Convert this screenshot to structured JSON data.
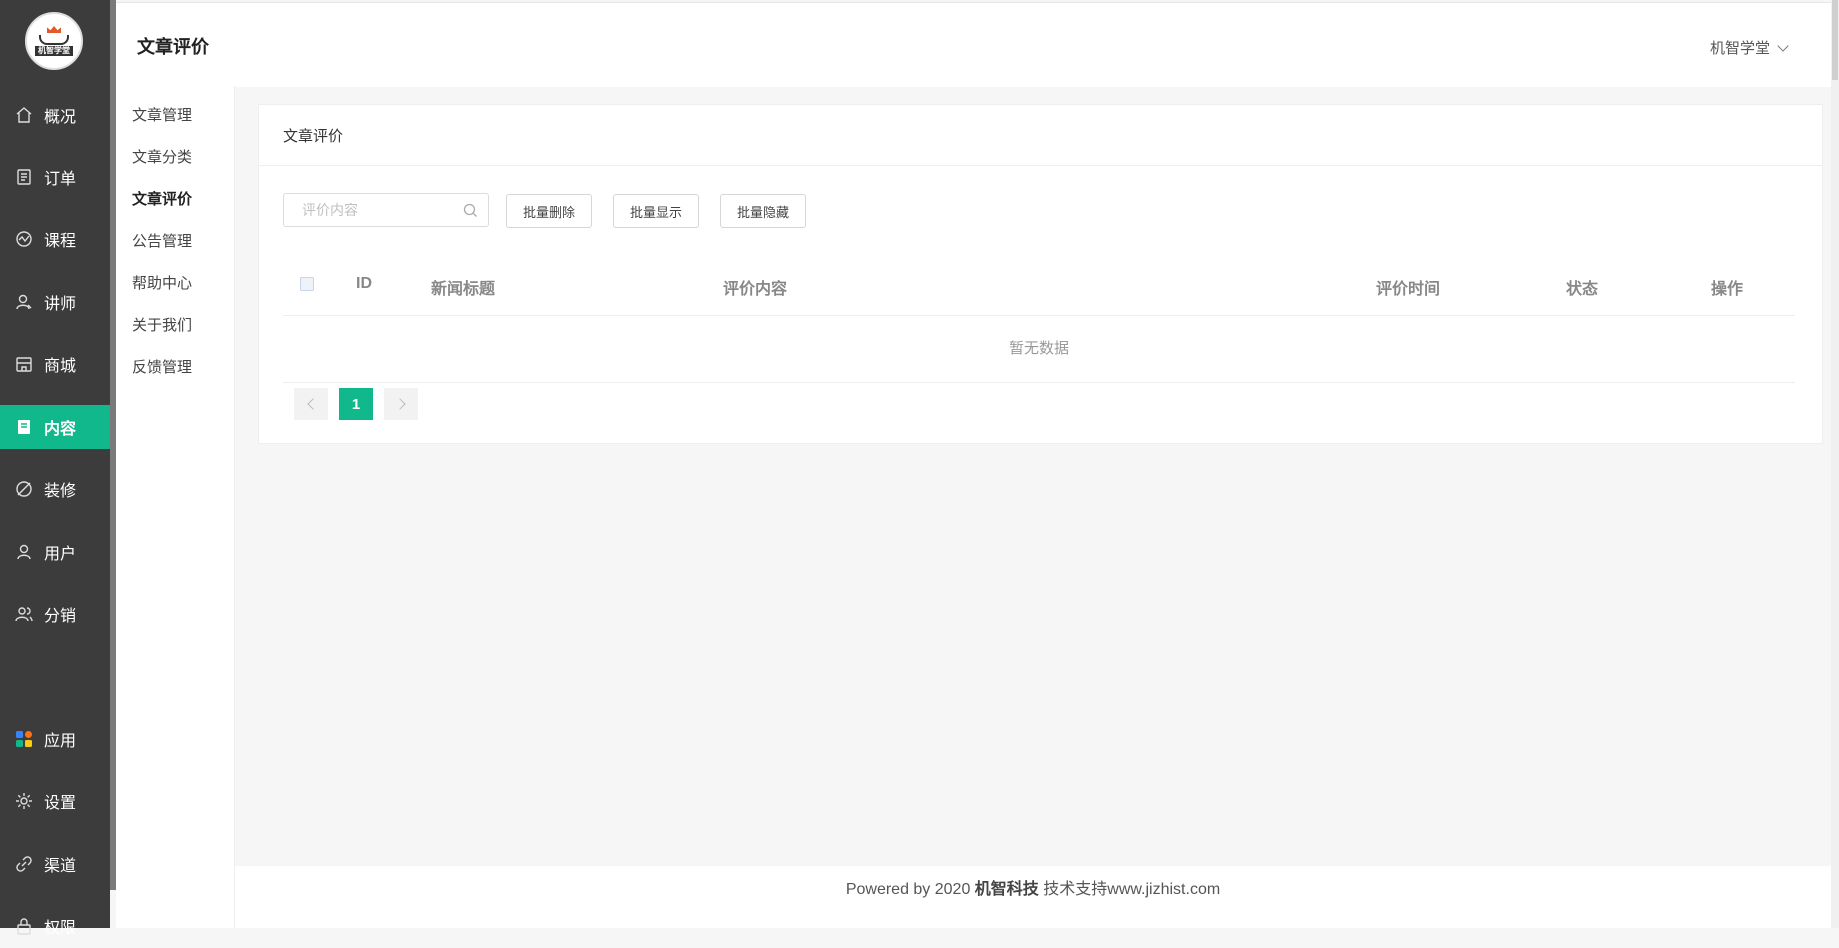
{
  "sidebar": {
    "logo_text": "机智学堂",
    "items": [
      {
        "label": "概况",
        "icon": "home-icon"
      },
      {
        "label": "订单",
        "icon": "order-icon"
      },
      {
        "label": "课程",
        "icon": "course-icon"
      },
      {
        "label": "讲师",
        "icon": "teacher-icon"
      },
      {
        "label": "商城",
        "icon": "store-icon"
      },
      {
        "label": "内容",
        "icon": "content-icon"
      },
      {
        "label": "装修",
        "icon": "decorate-icon"
      },
      {
        "label": "用户",
        "icon": "user-icon"
      },
      {
        "label": "分销",
        "icon": "distribution-icon"
      },
      {
        "label": "应用",
        "icon": "apps-icon"
      },
      {
        "label": "设置",
        "icon": "settings-icon"
      },
      {
        "label": "渠道",
        "icon": "channel-icon"
      },
      {
        "label": "权限",
        "icon": "permission-icon"
      }
    ],
    "active_index": 5
  },
  "header": {
    "title": "文章评价",
    "user_name": "机智学堂"
  },
  "submenu": {
    "items": [
      "文章管理",
      "文章分类",
      "文章评价",
      "公告管理",
      "帮助中心",
      "关于我们",
      "反馈管理"
    ],
    "active_index": 2
  },
  "card": {
    "title": "文章评价",
    "search_placeholder": "评价内容",
    "buttons": {
      "batch_delete": "批量删除",
      "batch_show": "批量显示",
      "batch_hide": "批量隐藏"
    },
    "table": {
      "columns": [
        "ID",
        "新闻标题",
        "评价内容",
        "评价时间",
        "状态",
        "操作"
      ],
      "rows": [],
      "empty_text": "暂无数据"
    },
    "pagination": {
      "current_page": "1"
    }
  },
  "footer": {
    "prefix": "Powered by 2020 ",
    "company": "机智科技",
    "suffix": " 技术支持www.jizhist.com"
  },
  "colors": {
    "accent": "#10b88c",
    "sidebar_bg": "#3c3c3c"
  }
}
